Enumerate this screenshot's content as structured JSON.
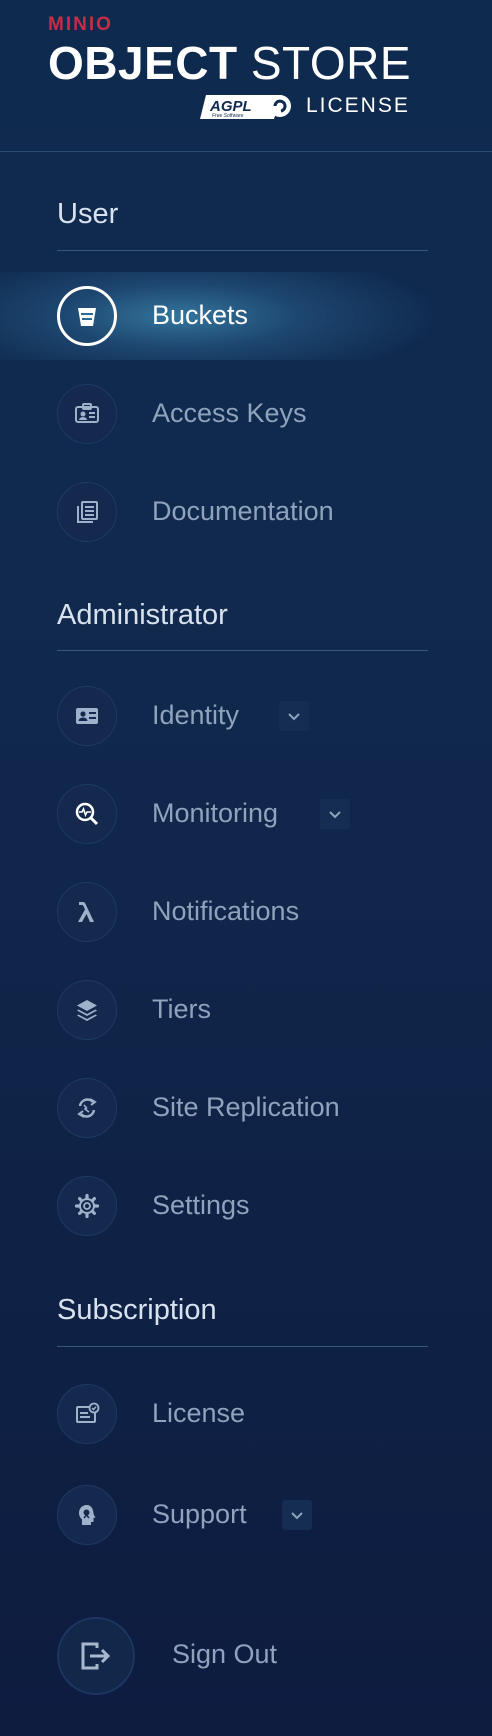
{
  "logo": {
    "brand": "MINIO",
    "product_bold": "OBJECT",
    "product_light": " STORE",
    "agpl": "AGPL",
    "agpl_sub": "Free Software",
    "license_word": "LICENSE"
  },
  "sections": {
    "user": "User",
    "administrator": "Administrator",
    "subscription": "Subscription"
  },
  "items": {
    "buckets": {
      "label": "Buckets",
      "icon": "bucket-icon",
      "active": true
    },
    "access_keys": {
      "label": "Access Keys",
      "icon": "id-card-icon"
    },
    "documentation": {
      "label": "Documentation",
      "icon": "document-icon"
    },
    "identity": {
      "label": "Identity",
      "icon": "identity-card-icon",
      "expandable": true
    },
    "monitoring": {
      "label": "Monitoring",
      "icon": "monitoring-icon",
      "expandable": true
    },
    "notifications": {
      "label": "Notifications",
      "icon": "lambda-icon"
    },
    "tiers": {
      "label": "Tiers",
      "icon": "layers-icon"
    },
    "site_replication": {
      "label": "Site Replication",
      "icon": "sync-icon"
    },
    "settings": {
      "label": "Settings",
      "icon": "gear-icon"
    },
    "license": {
      "label": "License",
      "icon": "license-icon"
    },
    "support": {
      "label": "Support",
      "icon": "support-icon",
      "expandable": true
    },
    "sign_out": {
      "label": "Sign Out",
      "icon": "logout-icon"
    }
  },
  "colors": {
    "background": "#0f2a4f",
    "accent_red": "#c72c48",
    "active_glow": "#3a82aa",
    "muted_text": "#8fa3bd"
  }
}
